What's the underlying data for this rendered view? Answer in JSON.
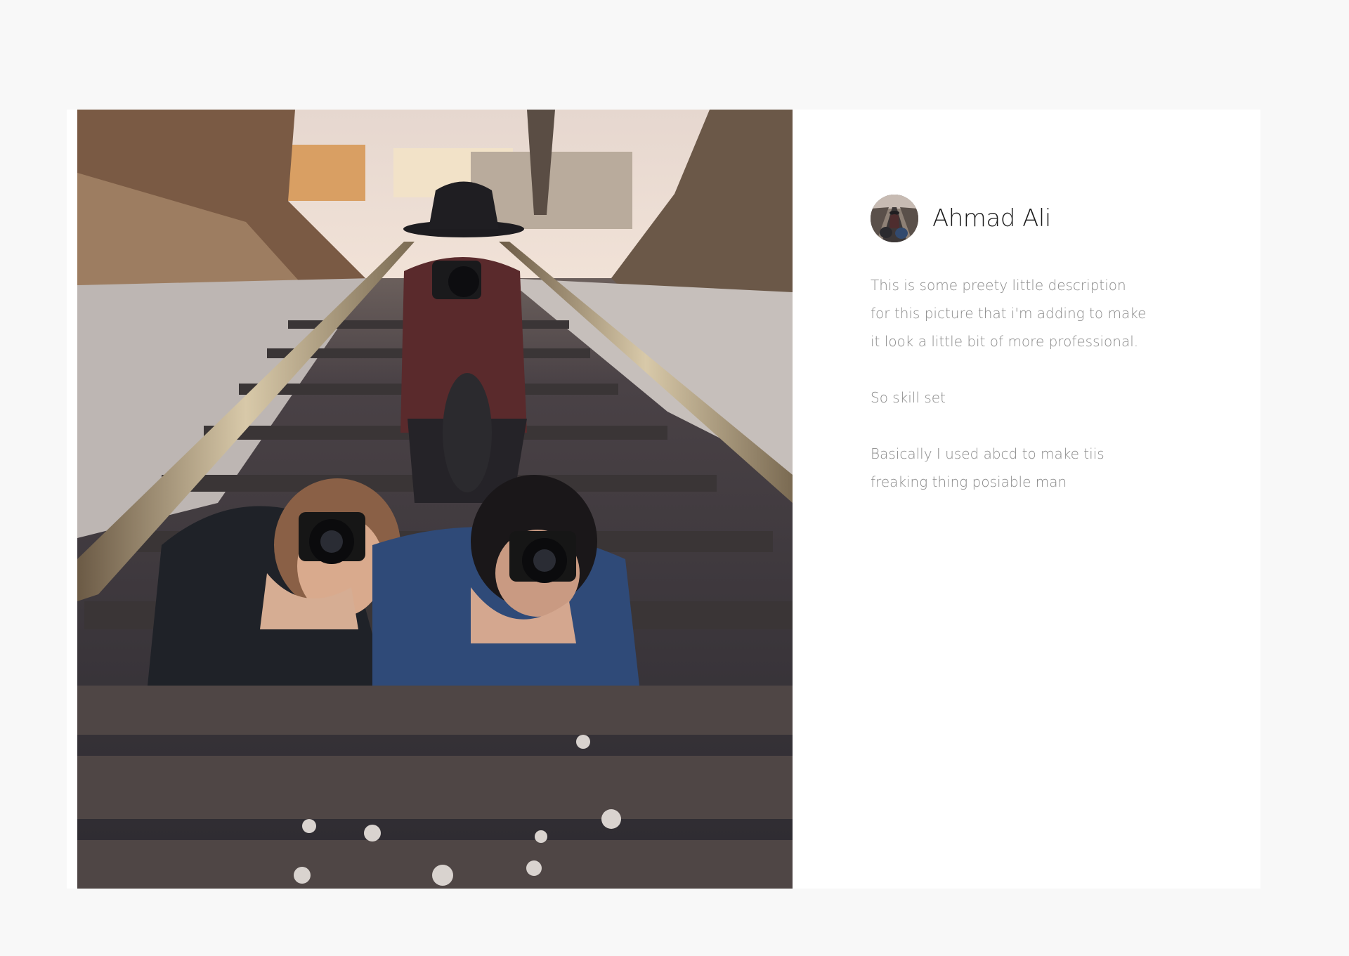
{
  "post": {
    "author_name": "Ahmad Ali",
    "avatar_icon": "avatar-photo",
    "image_icon": "railroad-photographers-photo",
    "description_lines": [
      "This is some preety little description",
      "for this  picture that i'm adding to make",
      "it look a little bit of more professional."
    ],
    "skills_line": "So skill set",
    "usage_lines": [
      "Basically I used abcd to make tiis",
      "freaking thing posiable man"
    ]
  },
  "colors": {
    "page_background": "#f8f8f8",
    "card_background": "#ffffff",
    "title_text": "#1b1b1b",
    "body_text": "#8a8a8a"
  }
}
